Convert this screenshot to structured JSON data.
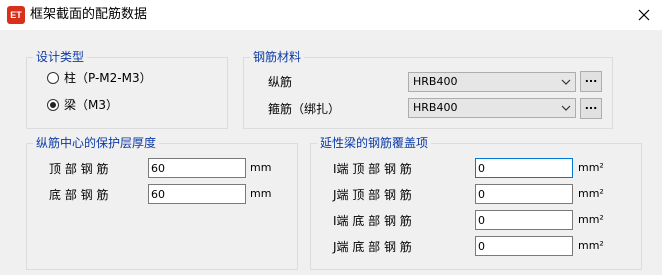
{
  "window": {
    "app_badge": "ET",
    "title": "框架截面的配筋数据"
  },
  "design_type": {
    "legend": "设计类型",
    "options": [
      {
        "label": "柱（P-M2-M3）",
        "selected": false
      },
      {
        "label": "梁（M3）",
        "selected": true
      }
    ]
  },
  "rebar_material": {
    "legend": "钢筋材料",
    "longitudinal": {
      "label": "纵筋",
      "value": "HRB400",
      "button": "..."
    },
    "stirrup": {
      "label": "箍筋（绑扎）",
      "value": "HRB400",
      "button": "..."
    }
  },
  "cover": {
    "legend": "纵筋中心的保护层厚度",
    "rows": [
      {
        "label": "顶 部 钢 筋",
        "value": "60",
        "unit": "mm"
      },
      {
        "label": "底 部 钢 筋",
        "value": "60",
        "unit": "mm"
      }
    ]
  },
  "overwrite": {
    "legend": "延性梁的钢筋覆盖项",
    "rows": [
      {
        "label": "I端 顶 部 钢 筋",
        "value": "0",
        "unit": "mm²"
      },
      {
        "label": "J端 顶 部 钢 筋",
        "value": "0",
        "unit": "mm²"
      },
      {
        "label": "I端 底 部 钢 筋",
        "value": "0",
        "unit": "mm²"
      },
      {
        "label": "J端 底 部 钢 筋",
        "value": "0",
        "unit": "mm²"
      }
    ]
  },
  "colors": {
    "legend_text": "#0b3aa6",
    "app_badge": "#d9301c",
    "focus_border": "#0078d7"
  }
}
